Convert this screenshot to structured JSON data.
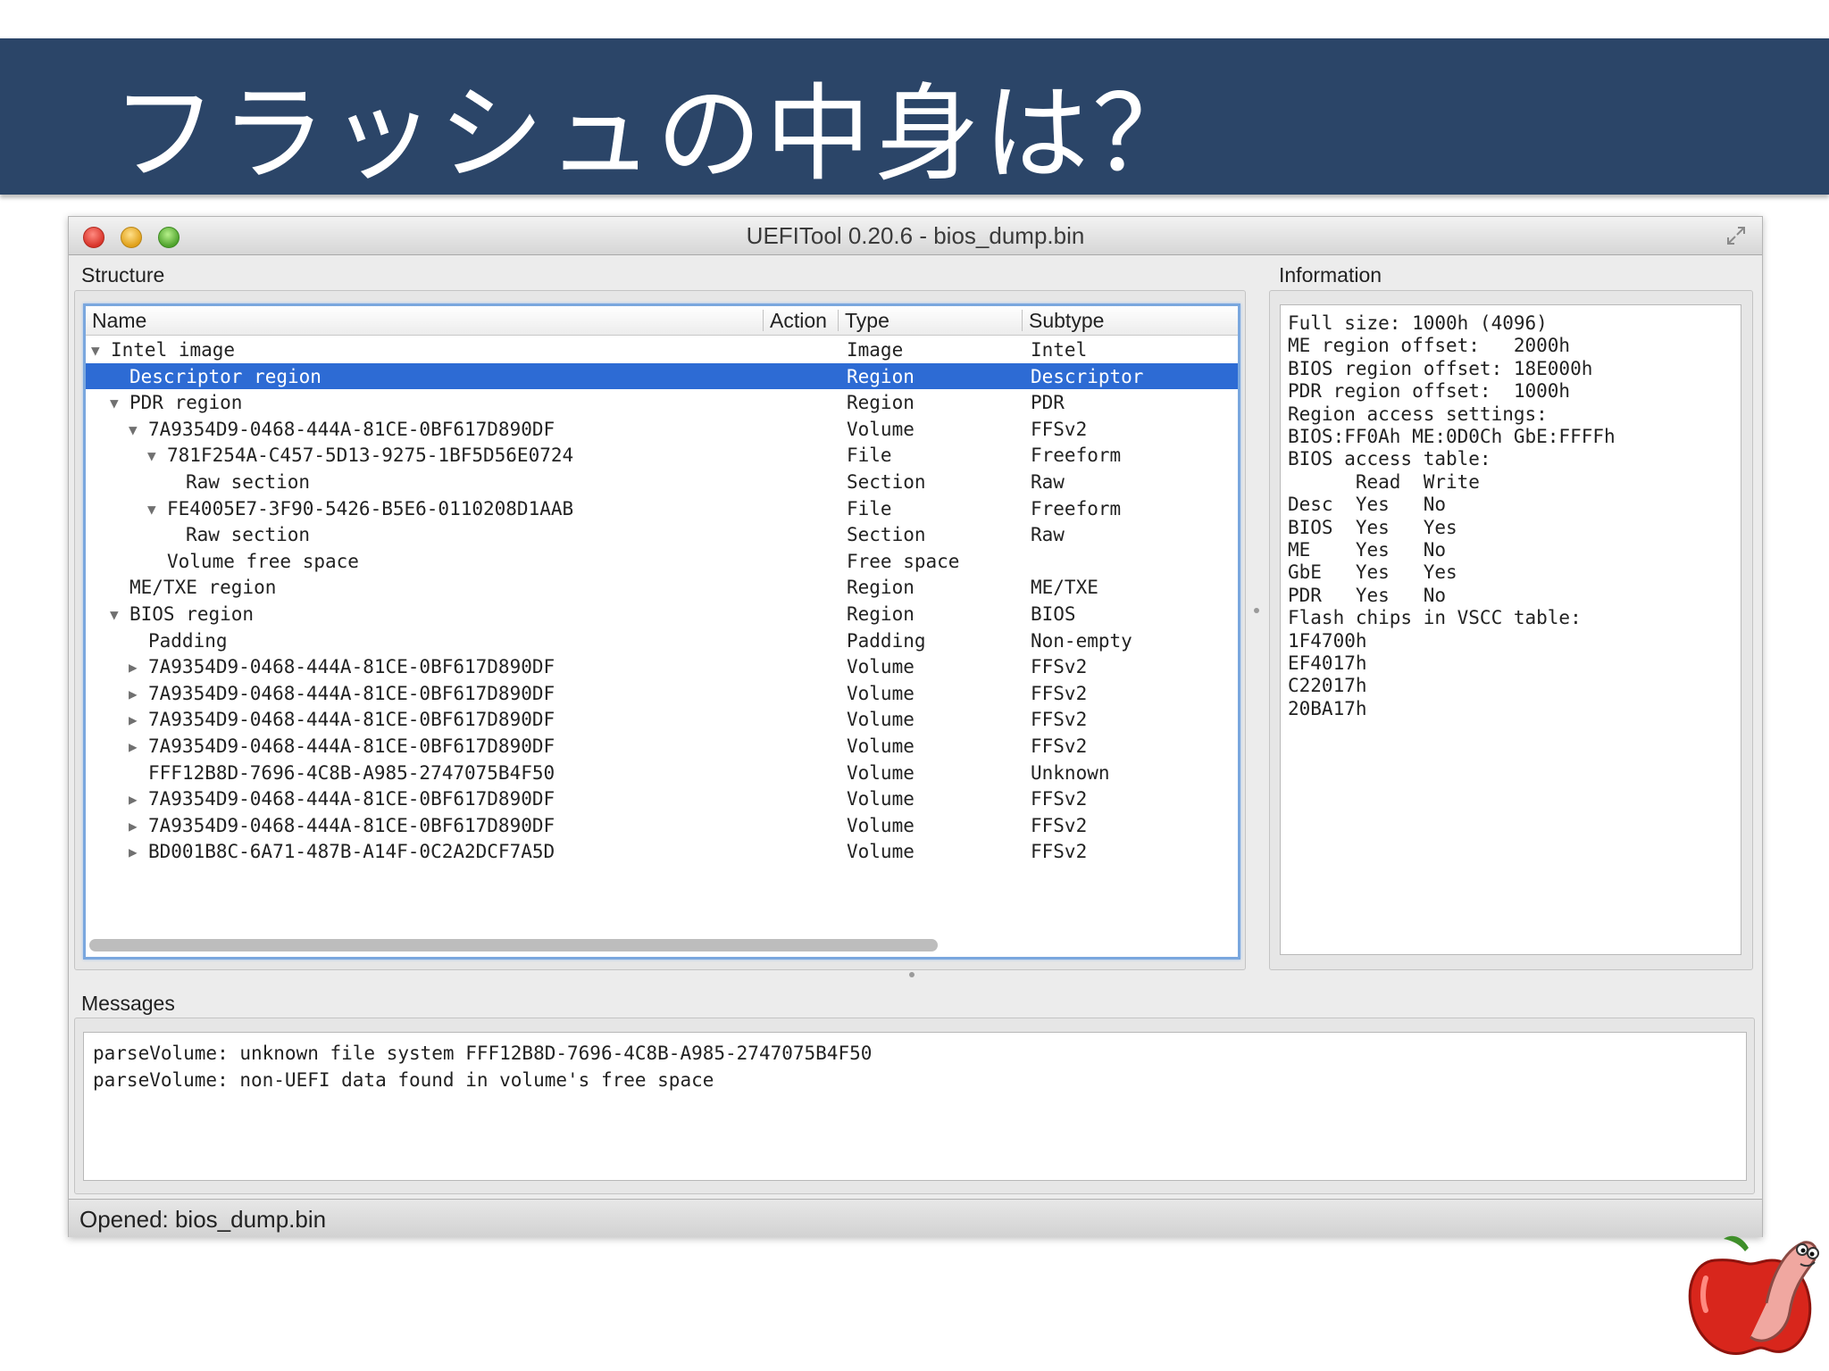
{
  "slide": {
    "title": "フラッシュの中身は？"
  },
  "window": {
    "title": "UEFITool 0.20.6 - bios_dump.bin"
  },
  "structure": {
    "label": "Structure",
    "columns": [
      "Name",
      "Action",
      "Type",
      "Subtype"
    ],
    "rows": [
      {
        "name": "Intel image",
        "type": "Image",
        "subtype": "Intel",
        "depth": 0,
        "expander": "expanded",
        "selected": false
      },
      {
        "name": "Descriptor region",
        "type": "Region",
        "subtype": "Descriptor",
        "depth": 1,
        "expander": "none",
        "selected": true
      },
      {
        "name": "PDR region",
        "type": "Region",
        "subtype": "PDR",
        "depth": 1,
        "expander": "expanded",
        "selected": false
      },
      {
        "name": "7A9354D9-0468-444A-81CE-0BF617D890DF",
        "type": "Volume",
        "subtype": "FFSv2",
        "depth": 2,
        "expander": "expanded",
        "selected": false
      },
      {
        "name": "781F254A-C457-5D13-9275-1BF5D56E0724",
        "type": "File",
        "subtype": "Freeform",
        "depth": 3,
        "expander": "expanded",
        "selected": false
      },
      {
        "name": "Raw section",
        "type": "Section",
        "subtype": "Raw",
        "depth": 4,
        "expander": "none",
        "selected": false
      },
      {
        "name": "FE4005E7-3F90-5426-B5E6-0110208D1AAB",
        "type": "File",
        "subtype": "Freeform",
        "depth": 3,
        "expander": "expanded",
        "selected": false
      },
      {
        "name": "Raw section",
        "type": "Section",
        "subtype": "Raw",
        "depth": 4,
        "expander": "none",
        "selected": false
      },
      {
        "name": "Volume free space",
        "type": "Free space",
        "subtype": "",
        "depth": 3,
        "expander": "none",
        "selected": false
      },
      {
        "name": "ME/TXE region",
        "type": "Region",
        "subtype": "ME/TXE",
        "depth": 1,
        "expander": "none",
        "selected": false
      },
      {
        "name": "BIOS region",
        "type": "Region",
        "subtype": "BIOS",
        "depth": 1,
        "expander": "expanded",
        "selected": false
      },
      {
        "name": "Padding",
        "type": "Padding",
        "subtype": "Non-empty",
        "depth": 2,
        "expander": "none",
        "selected": false
      },
      {
        "name": "7A9354D9-0468-444A-81CE-0BF617D890DF",
        "type": "Volume",
        "subtype": "FFSv2",
        "depth": 2,
        "expander": "collapsed",
        "selected": false
      },
      {
        "name": "7A9354D9-0468-444A-81CE-0BF617D890DF",
        "type": "Volume",
        "subtype": "FFSv2",
        "depth": 2,
        "expander": "collapsed",
        "selected": false
      },
      {
        "name": "7A9354D9-0468-444A-81CE-0BF617D890DF",
        "type": "Volume",
        "subtype": "FFSv2",
        "depth": 2,
        "expander": "collapsed",
        "selected": false
      },
      {
        "name": "7A9354D9-0468-444A-81CE-0BF617D890DF",
        "type": "Volume",
        "subtype": "FFSv2",
        "depth": 2,
        "expander": "collapsed",
        "selected": false
      },
      {
        "name": "FFF12B8D-7696-4C8B-A985-2747075B4F50",
        "type": "Volume",
        "subtype": "Unknown",
        "depth": 2,
        "expander": "none",
        "selected": false
      },
      {
        "name": "7A9354D9-0468-444A-81CE-0BF617D890DF",
        "type": "Volume",
        "subtype": "FFSv2",
        "depth": 2,
        "expander": "collapsed",
        "selected": false
      },
      {
        "name": "7A9354D9-0468-444A-81CE-0BF617D890DF",
        "type": "Volume",
        "subtype": "FFSv2",
        "depth": 2,
        "expander": "collapsed",
        "selected": false
      },
      {
        "name": "BD001B8C-6A71-487B-A14F-0C2A2DCF7A5D",
        "type": "Volume",
        "subtype": "FFSv2",
        "depth": 2,
        "expander": "collapsed",
        "selected": false
      }
    ]
  },
  "information": {
    "label": "Information",
    "lines": [
      "Full size: 1000h (4096)",
      "ME region offset:   2000h",
      "BIOS region offset: 18E000h",
      "PDR region offset:  1000h",
      "Region access settings:",
      "BIOS:FF0Ah ME:0D0Ch GbE:FFFFh",
      "BIOS access table:",
      "      Read  Write",
      "Desc  Yes   No",
      "BIOS  Yes   Yes",
      "ME    Yes   No",
      "GbE   Yes   Yes",
      "PDR   Yes   No",
      "Flash chips in VSCC table:",
      "1F4700h",
      "EF4017h",
      "C22017h",
      "20BA17h"
    ]
  },
  "messages": {
    "label": "Messages",
    "lines": [
      "parseVolume: unknown file system FFF12B8D-7696-4C8B-A985-2747075B4F50",
      "parseVolume: non-UEFI data found in volume's free space"
    ]
  },
  "status": {
    "text": "Opened: bios_dump.bin"
  },
  "icons": {
    "expanded": "triangle-down",
    "collapsed": "triangle-right",
    "logo": "apple-worm-logo"
  },
  "colors": {
    "title_band": "#2b4568",
    "selection": "#2d6bd4",
    "focus_border": "#7aa7de"
  }
}
